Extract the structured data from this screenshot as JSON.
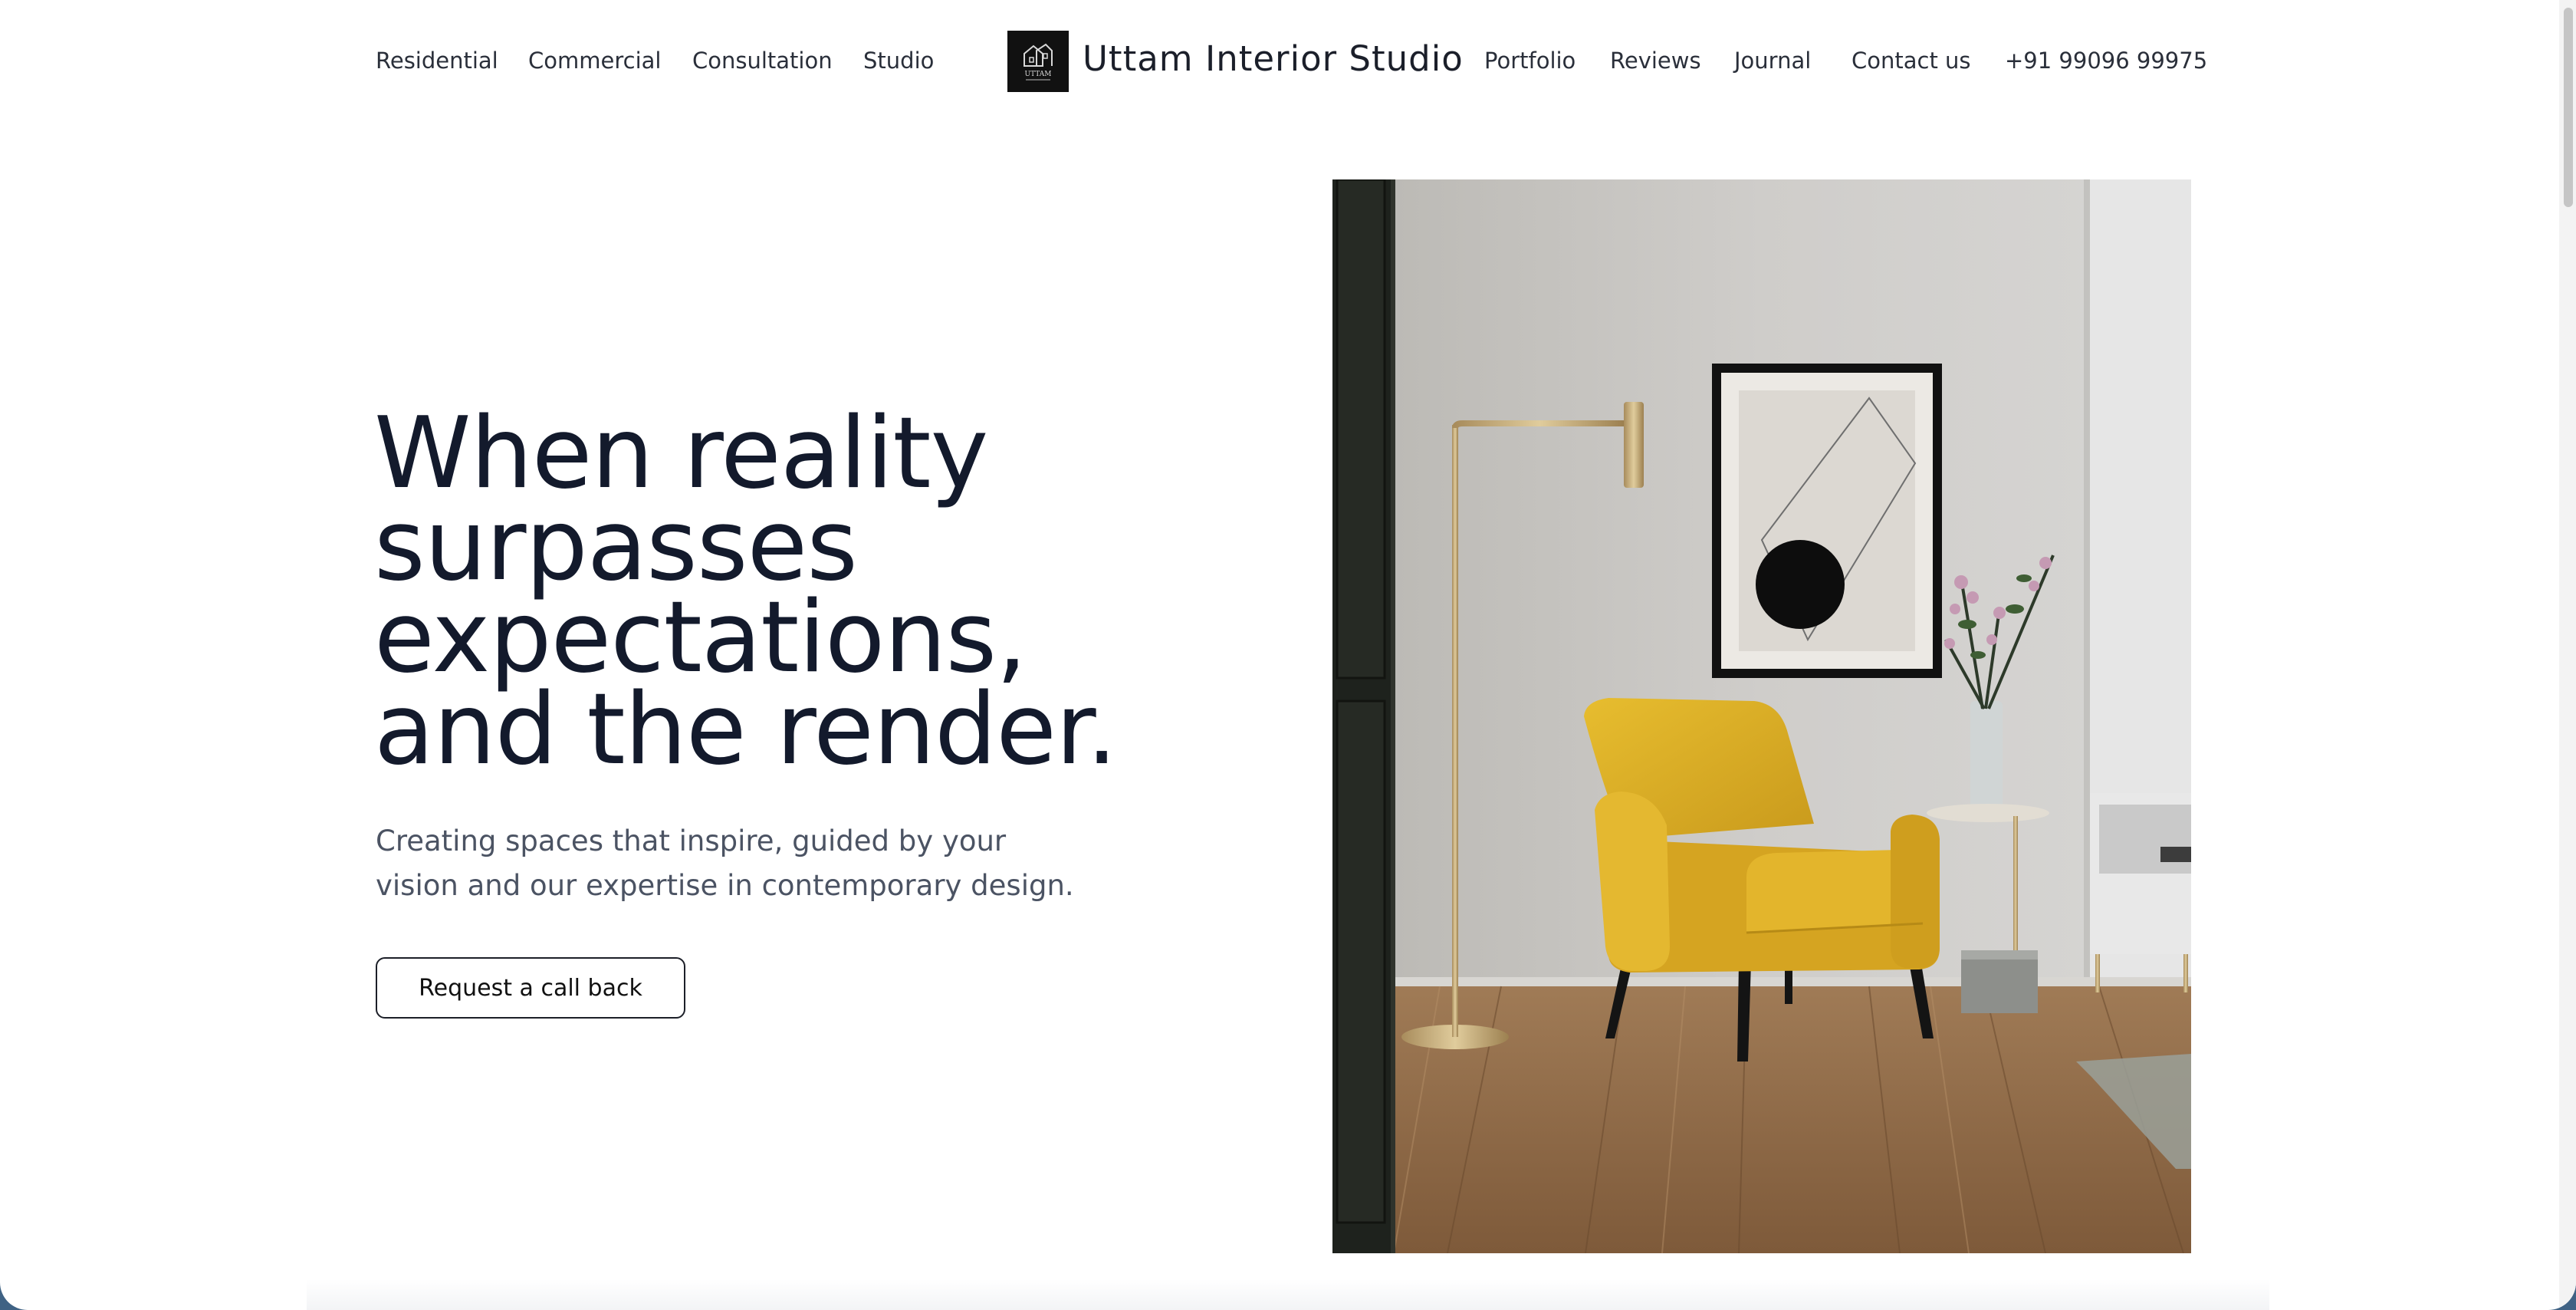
{
  "nav": {
    "left": [
      {
        "label": "Residential"
      },
      {
        "label": "Commercial"
      },
      {
        "label": "Consultation"
      },
      {
        "label": "Studio"
      }
    ],
    "right": [
      {
        "label": "Portfolio"
      },
      {
        "label": "Reviews"
      },
      {
        "label": "Journal"
      },
      {
        "label": "Contact us"
      },
      {
        "label": "+91 99096 99975"
      }
    ]
  },
  "brand": {
    "name": "Uttam Interior Studio",
    "logo_text": "UTTAM"
  },
  "hero": {
    "title": "When reality surpasses expectations, and the render.",
    "subtitle": "Creating spaces that inspire, guided by your vision and our expertise in contemporary design.",
    "cta_label": "Request a call back"
  },
  "colors": {
    "background": "#ffffff",
    "heading": "#131a2c",
    "body_text": "#4b5363",
    "chair": "#e0b52b",
    "floor": "#9a7350"
  },
  "icons": {
    "logo": "house-outline-icon"
  }
}
